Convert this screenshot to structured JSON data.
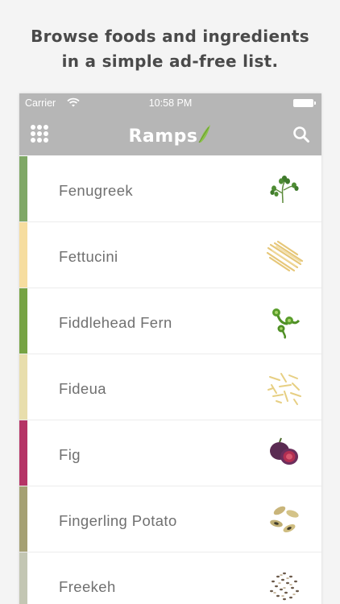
{
  "headline": {
    "line1": "Browse foods and ingredients",
    "line2": "in a simple ad-free list."
  },
  "status_bar": {
    "carrier": "Carrier",
    "time": "10:58 PM",
    "wifi_icon": "wifi-icon",
    "battery_icon": "battery-icon"
  },
  "nav": {
    "title": "Ramps",
    "menu_icon": "grid-menu-icon",
    "search_icon": "search-icon",
    "logo_icon": "leaf-icon",
    "bar_color": "#b6b6b6"
  },
  "foods": [
    {
      "label": "Fenugreek",
      "color": "#7fa866",
      "icon": "fenugreek-sprout-icon"
    },
    {
      "label": "Fettucini",
      "color": "#f6dd9f",
      "icon": "pasta-strands-icon"
    },
    {
      "label": "Fiddlehead Fern",
      "color": "#76a343",
      "icon": "fiddlehead-icon"
    },
    {
      "label": "Fideua",
      "color": "#e8deac",
      "icon": "short-noodles-icon"
    },
    {
      "label": "Fig",
      "color": "#b53466",
      "icon": "fig-icon"
    },
    {
      "label": "Fingerling Potato",
      "color": "#a5a073",
      "icon": "potato-icon"
    },
    {
      "label": "Freekeh",
      "color": "#c3c6b3",
      "icon": "grain-icon"
    }
  ]
}
